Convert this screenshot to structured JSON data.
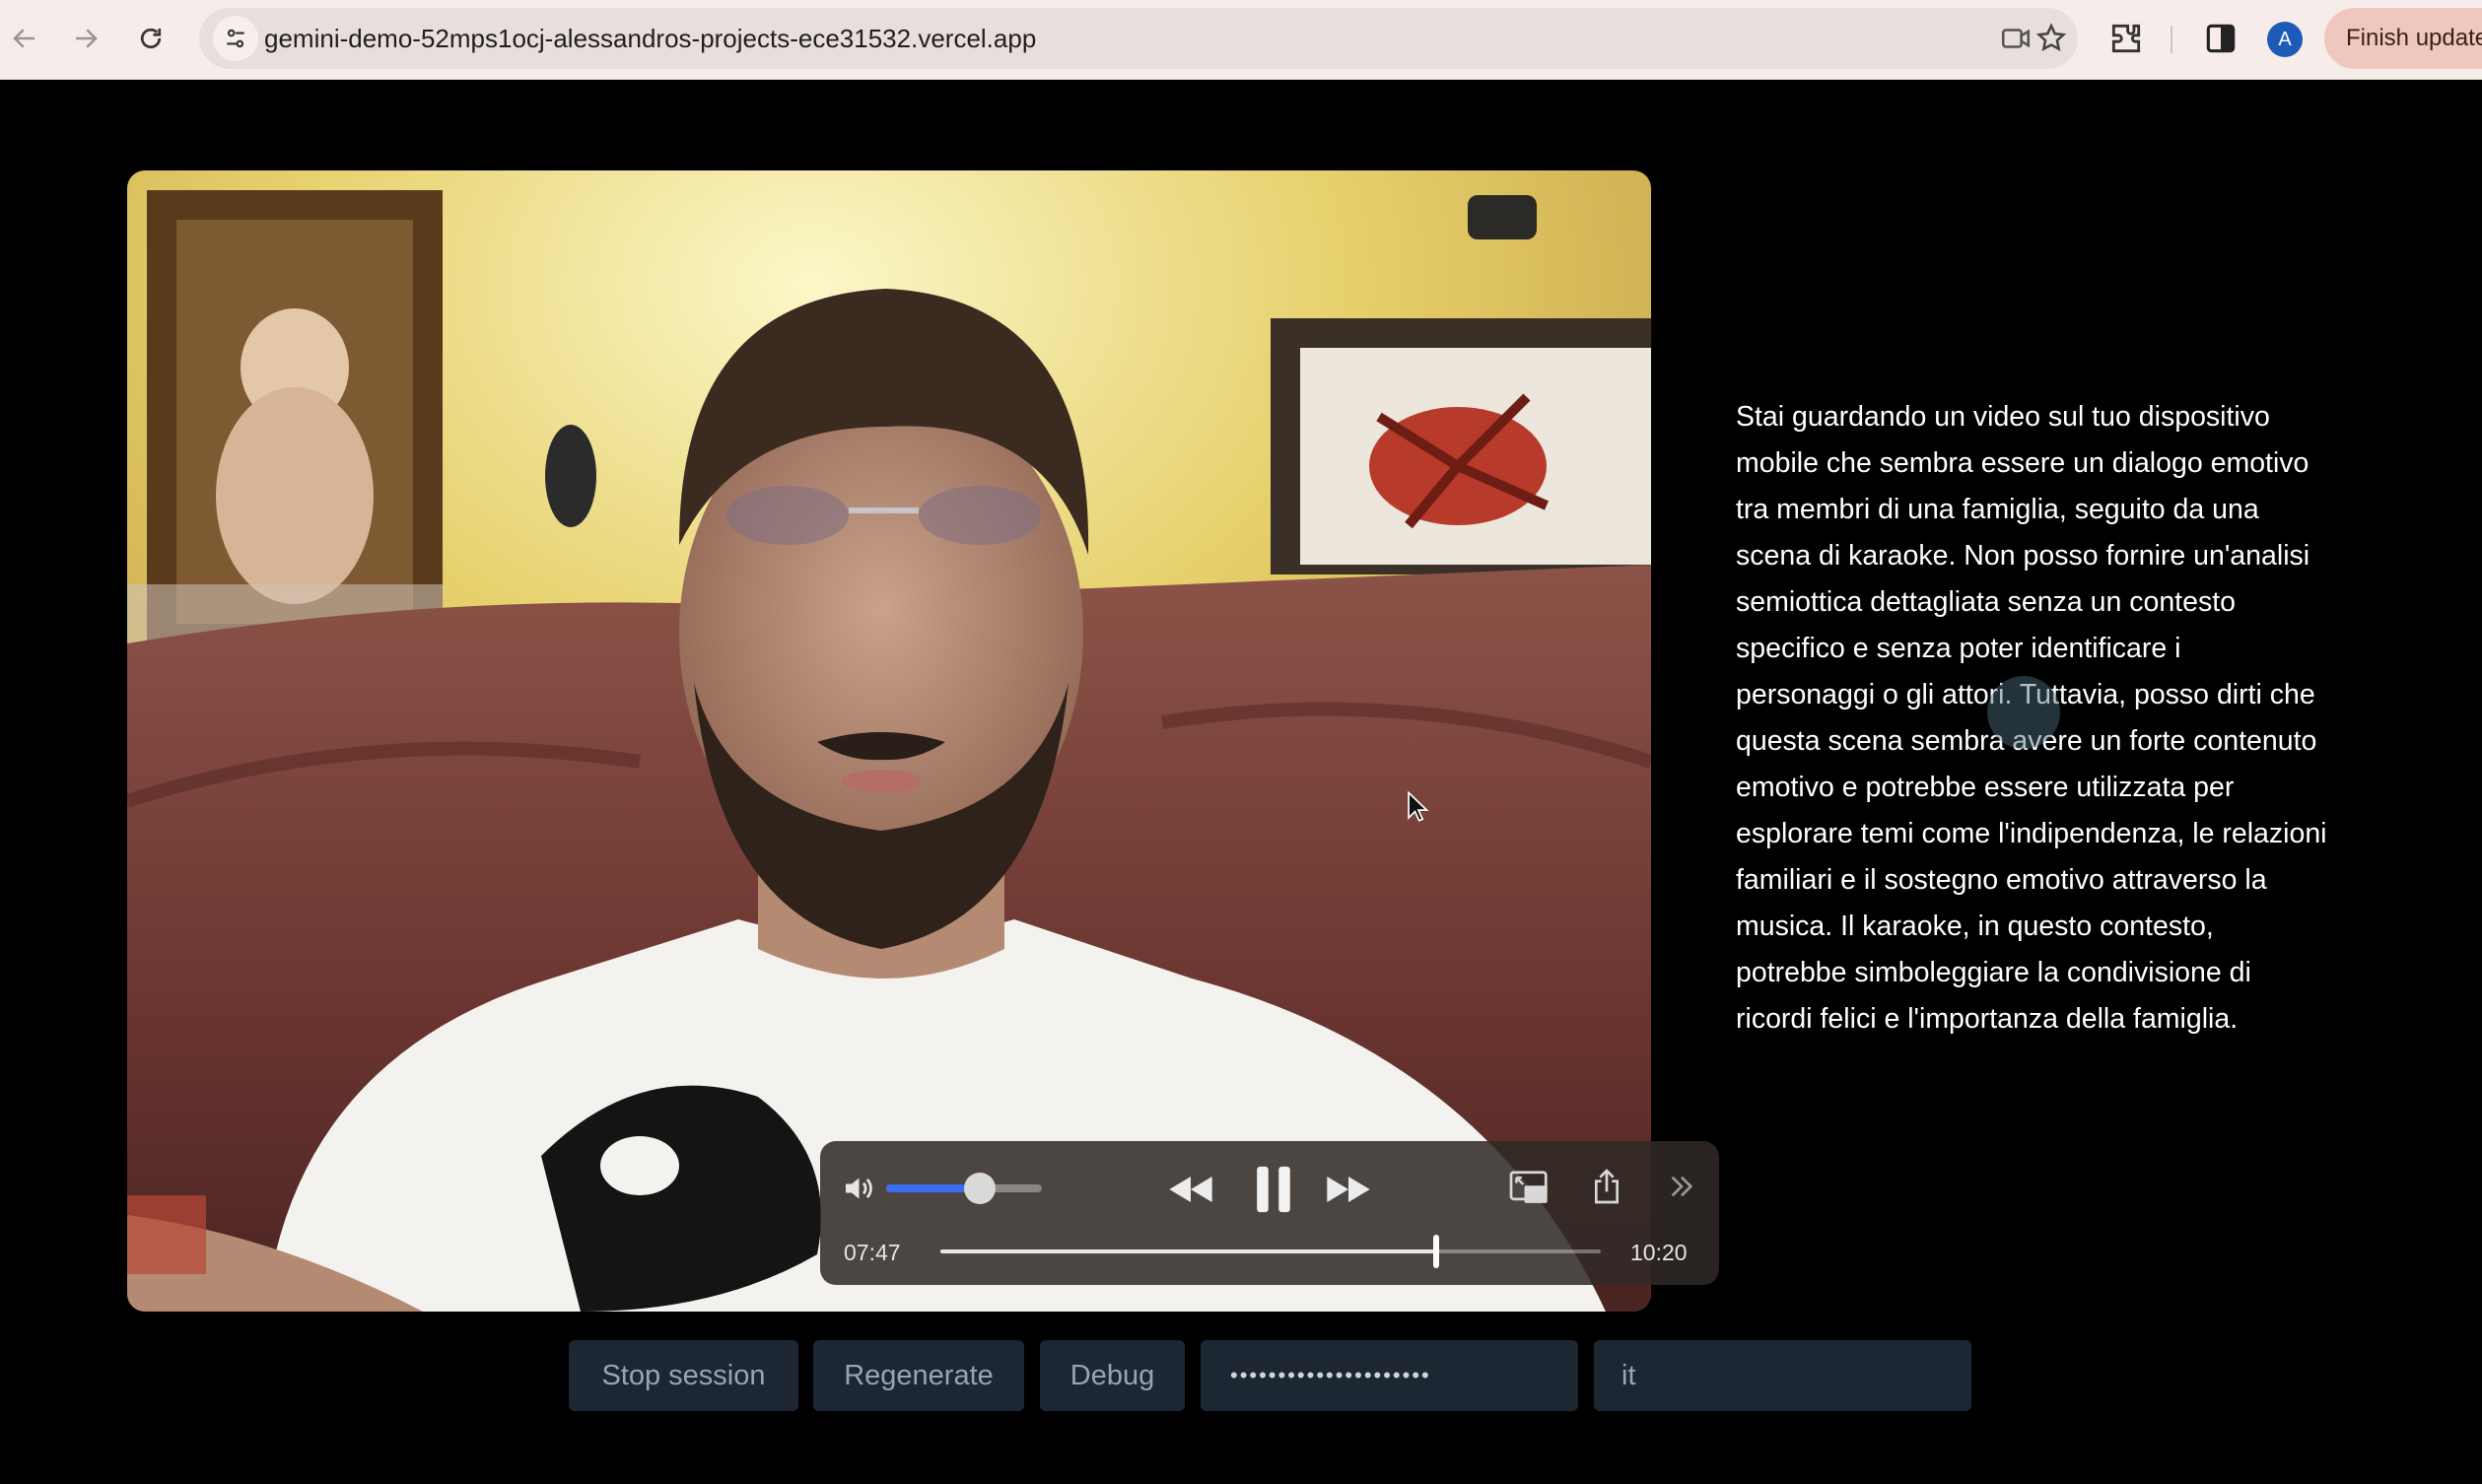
{
  "browser": {
    "url": "gemini-demo-52mps1ocj-alessandros-projects-ece31532.vercel.app",
    "profile_initial": "A",
    "update_label": "Finish update"
  },
  "player": {
    "current_time": "07:47",
    "duration": "10:20",
    "volume": 0.6,
    "progress": 0.75,
    "state": "playing"
  },
  "response_text": "Stai guardando un video sul tuo dispositivo mobile che sembra essere un dialogo emotivo tra membri di una famiglia, seguito da una scena di karaoke. Non posso fornire un'analisi semiottica dettagliata senza un contesto specifico e senza poter identificare i personaggi o gli attori. Tuttavia, posso dirti che questa scena sembra avere un forte contenuto emotivo e potrebbe essere utilizzata per esplorare temi come l'indipendenza, le relazioni familiari e il sostegno emotivo attraverso la musica. Il karaoke, in questo contesto, potrebbe simboleggiare la condivisione di ricordi felici e l'importanza della famiglia.",
  "actions": {
    "stop_label": "Stop session",
    "regenerate_label": "Regenerate",
    "debug_label": "Debug",
    "api_key_masked": "•••••••••••••••••••••",
    "language_value": "it"
  },
  "colors": {
    "accent_blue": "#3a6df0",
    "button_bg": "#1d2733",
    "update_bg": "#efc7bd"
  }
}
